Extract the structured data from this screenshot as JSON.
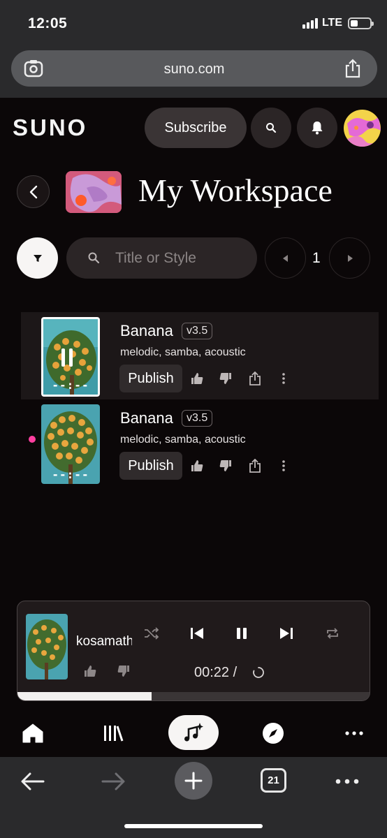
{
  "status_bar": {
    "time": "12:05",
    "network": "LTE"
  },
  "browser": {
    "domain": "suno.com"
  },
  "header": {
    "logo": "SUNO",
    "subscribe_label": "Subscribe"
  },
  "workspace": {
    "title": "My Workspace"
  },
  "filters": {
    "search_placeholder": "Title or Style",
    "page": "1"
  },
  "songs": [
    {
      "title": "Banana",
      "version": "v3.5",
      "tags": "melodic, samba, acoustic",
      "duration": "--:--",
      "publish_label": "Publish",
      "playing": true,
      "new": false
    },
    {
      "title": "Banana",
      "version": "v3.5",
      "tags": "melodic, samba, acoustic",
      "duration": "--:--",
      "publish_label": "Publish",
      "playing": false,
      "new": true
    }
  ],
  "player": {
    "track_name": "kosamatha",
    "time": "00:22 /",
    "progress": 0.38
  },
  "browser_toolbar": {
    "tab_count": "21"
  },
  "colors": {
    "accent_dot": "#ff3fa0",
    "background": "#0b0708"
  }
}
